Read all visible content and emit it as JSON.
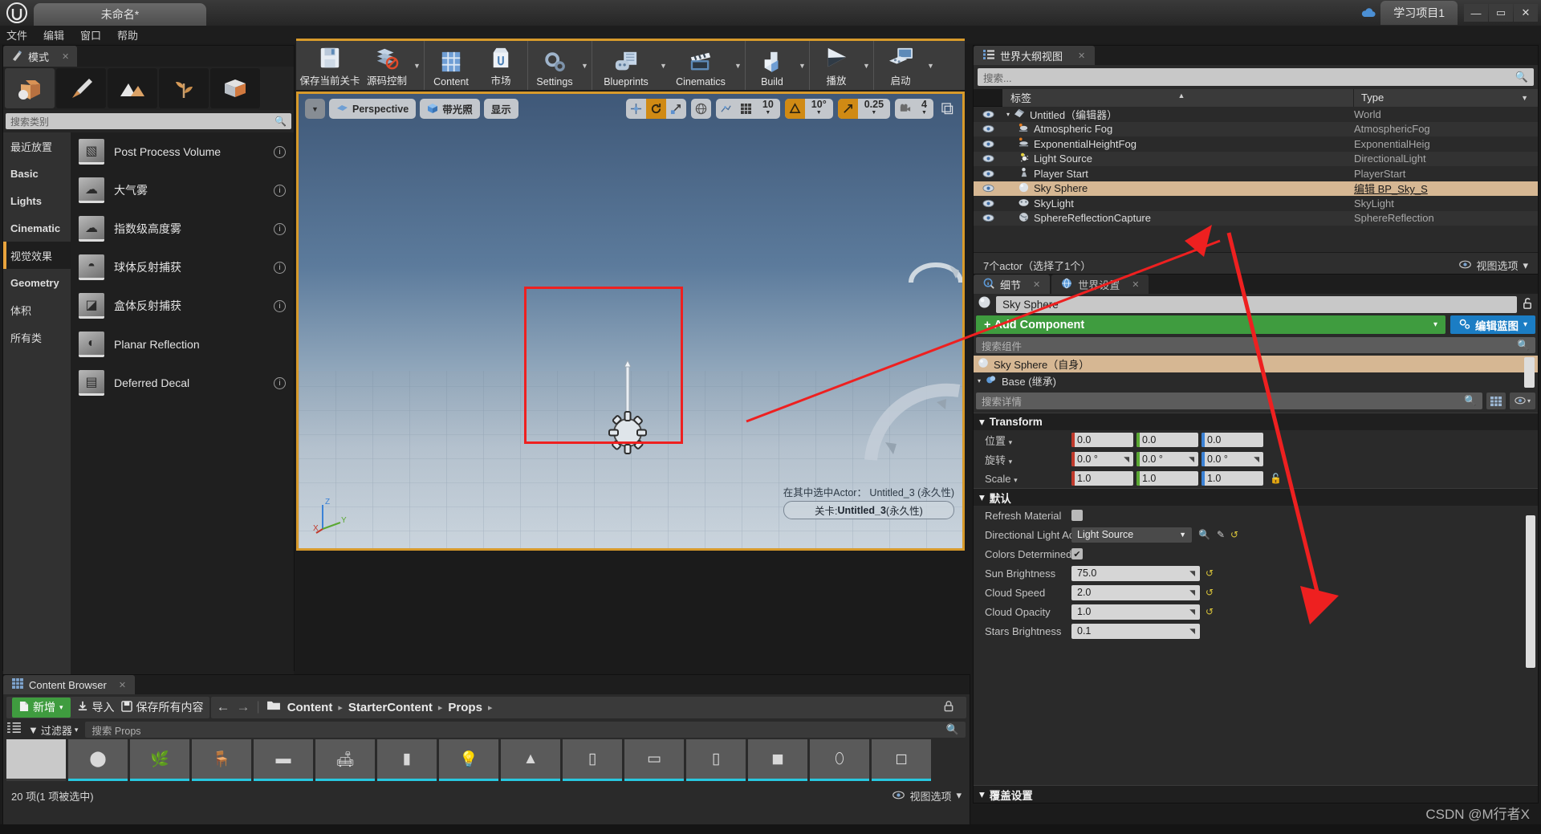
{
  "window": {
    "tab_title": "未命名*",
    "learn_tab": "学习项目1",
    "minimize": "—",
    "maximize": "▭",
    "close": "✕",
    "cloud_icon": "cloud-icon"
  },
  "menubar": {
    "items": [
      "文件",
      "编辑",
      "窗口",
      "帮助"
    ]
  },
  "modes": {
    "tab_label": "模式",
    "tab_close": "✕",
    "mode_icons": [
      "place-mode-icon",
      "paint-mode-icon",
      "landscape-mode-icon",
      "foliage-mode-icon",
      "geometry-mode-icon"
    ],
    "search_placeholder": "搜索类别",
    "categories": [
      {
        "label": "最近放置",
        "selected": false,
        "bold": false
      },
      {
        "label": "Basic",
        "selected": false,
        "bold": true
      },
      {
        "label": "Lights",
        "selected": false,
        "bold": true
      },
      {
        "label": "Cinematic",
        "selected": false,
        "bold": true
      },
      {
        "label": "视觉效果",
        "selected": true,
        "bold": false
      },
      {
        "label": "Geometry",
        "selected": false,
        "bold": true
      },
      {
        "label": "体积",
        "selected": false,
        "bold": false
      },
      {
        "label": "所有类",
        "selected": false,
        "bold": false
      }
    ],
    "items": [
      {
        "label": "Post Process Volume",
        "check": "✓"
      },
      {
        "label": "大气雾",
        "check": "✓"
      },
      {
        "label": "指数级高度雾",
        "check": "✓"
      },
      {
        "label": "球体反射捕获",
        "check": "✓"
      },
      {
        "label": "盒体反射捕获",
        "check": "✓"
      },
      {
        "label": "Planar Reflection",
        "check": ""
      },
      {
        "label": "Deferred Decal",
        "check": "✓"
      }
    ]
  },
  "toolbar": {
    "groups": [
      {
        "buttons": [
          {
            "label": "保存当前关卡",
            "icon": "save-icon",
            "caret": false,
            "wide": true
          },
          {
            "label": "源码控制",
            "icon": "source-control-icon",
            "caret": true,
            "wide": false
          }
        ]
      },
      {
        "buttons": [
          {
            "label": "Content",
            "icon": "content-icon",
            "caret": false,
            "wide": false
          },
          {
            "label": "市场",
            "icon": "marketplace-icon",
            "caret": false,
            "wide": false
          }
        ]
      },
      {
        "buttons": [
          {
            "label": "Settings",
            "icon": "gear-icon",
            "caret": true,
            "wide": false
          }
        ]
      },
      {
        "buttons": [
          {
            "label": "Blueprints",
            "icon": "blueprints-icon",
            "caret": true,
            "wide": true
          },
          {
            "label": "Cinematics",
            "icon": "cinematics-icon",
            "caret": true,
            "wide": true
          }
        ]
      },
      {
        "buttons": [
          {
            "label": "Build",
            "icon": "build-icon",
            "caret": true,
            "wide": false
          }
        ]
      },
      {
        "buttons": [
          {
            "label": "播放",
            "icon": "play-icon",
            "caret": true,
            "wide": false
          }
        ]
      },
      {
        "buttons": [
          {
            "label": "启动",
            "icon": "launch-icon",
            "caret": true,
            "wide": false
          }
        ]
      }
    ]
  },
  "viewport": {
    "caret": "▼",
    "perspective": "Perspective",
    "lit": "带光照",
    "show": "显示",
    "transform_modes": [
      "translate-icon",
      "rotate-icon",
      "scale-icon"
    ],
    "coord_icon": "world-coordinate-icon",
    "surface_snap_icon": "surface-snap-icon",
    "grid_icon": "grid-snap-icon",
    "grid_value": "10",
    "angle_icon": "angle-snap-icon",
    "angle_value": "10°",
    "scale_icon": "scale-snap-icon",
    "scale_value": "0.25",
    "camera_icon": "camera-speed-icon",
    "camera_value": "4",
    "maximize_icon": "maximize-viewport-icon",
    "status_line": "在其中选中Actor： Untitled_3 (永久性)",
    "level_prefix": "关卡: ",
    "level_name": "Untitled_3",
    "level_suffix": " (永久性)",
    "axis_x": "X",
    "axis_y": "Y",
    "axis_z": "Z"
  },
  "outliner": {
    "tab_label": "世界大纲视图",
    "tab_icon": "outliner-icon",
    "search_placeholder": "搜索...",
    "col_label": "标签",
    "col_type": "Type",
    "rows": [
      {
        "label": "Untitled（编辑器）",
        "type": "World",
        "icon": "world-icon",
        "indent": 0,
        "selected": false,
        "expander": "▾"
      },
      {
        "label": "Atmospheric Fog",
        "type": "AtmosphericFog",
        "icon": "fog-icon",
        "indent": 1,
        "selected": false,
        "expander": ""
      },
      {
        "label": "ExponentialHeightFog",
        "type": "ExponentialHeig",
        "icon": "height-fog-icon",
        "indent": 1,
        "selected": false,
        "expander": ""
      },
      {
        "label": "Light Source",
        "type": "DirectionalLight",
        "icon": "directional-light-icon",
        "indent": 1,
        "selected": false,
        "expander": ""
      },
      {
        "label": "Player Start",
        "type": "PlayerStart",
        "icon": "player-start-icon",
        "indent": 1,
        "selected": false,
        "expander": ""
      },
      {
        "label": "Sky Sphere",
        "type": "编辑 BP_Sky_S",
        "icon": "sky-sphere-icon",
        "indent": 1,
        "selected": true,
        "expander": ""
      },
      {
        "label": "SkyLight",
        "type": "SkyLight",
        "icon": "sky-light-icon",
        "indent": 1,
        "selected": false,
        "expander": ""
      },
      {
        "label": "SphereReflectionCapture",
        "type": "SphereReflection",
        "icon": "sphere-reflection-icon",
        "indent": 1,
        "selected": false,
        "expander": ""
      }
    ],
    "footer_count": "7个actor（选择了1个）",
    "footer_view_options": "视图选项",
    "footer_eye_icon": "eye-icon",
    "footer_caret": "▾"
  },
  "details": {
    "tab_details": "细节",
    "tab_details_icon": "details-icon",
    "tab_world_settings": "世界设置",
    "tab_world_icon": "world-settings-icon",
    "tab_close": "✕",
    "actor_name": "Sky Sphere",
    "actor_icon": "sphere-icon",
    "lock_icon": "unlock-icon",
    "add_component": "Add Component",
    "add_component_plus": "+",
    "add_component_caret": "▾",
    "edit_blueprint": "编辑蓝图",
    "edit_blueprint_icon": "gear-icon",
    "edit_blueprint_caret": "▾",
    "component_search_placeholder": "搜索组件",
    "components": [
      {
        "label": "Sky Sphere（自身）",
        "icon": "sphere-icon",
        "selected": true,
        "expander": ""
      },
      {
        "label": "Base (继承)",
        "icon": "mesh-icon",
        "selected": false,
        "expander": "▾"
      }
    ],
    "detail_search_placeholder": "搜索详情",
    "grid_button_icon": "grid-view-icon",
    "eye_button_icon": "eye-icon",
    "eye_caret": "▾",
    "transform_section": "Transform",
    "transform_rows": [
      {
        "label": "位置",
        "caret": "▾",
        "values": [
          "0.0",
          "0.0",
          "0.0"
        ],
        "suffix": ""
      },
      {
        "label": "旋转",
        "caret": "▾",
        "values": [
          "0.0 °",
          "0.0 °",
          "0.0 °"
        ],
        "suffix": "drag"
      },
      {
        "label": "Scale",
        "caret": "▾",
        "values": [
          "1.0",
          "1.0",
          "1.0"
        ],
        "suffix": "lock"
      }
    ],
    "default_section": "默认",
    "default_rows": [
      {
        "label": "Refresh Material",
        "kind": "checkbox",
        "checked": false,
        "value": ""
      },
      {
        "label": "Directional Light Ac",
        "kind": "combo",
        "value": "Light Source",
        "extra_icons": [
          "search-icon",
          "eyedropper-icon",
          "reset-icon"
        ]
      },
      {
        "label": "Colors Determined",
        "kind": "checkbox",
        "checked": true,
        "value": ""
      },
      {
        "label": "Sun Brightness",
        "kind": "number",
        "value": "75.0",
        "reset": true
      },
      {
        "label": "Cloud Speed",
        "kind": "number",
        "value": "2.0",
        "reset": true
      },
      {
        "label": "Cloud Opacity",
        "kind": "number",
        "value": "1.0",
        "reset": true
      },
      {
        "label": "Stars Brightness",
        "kind": "number",
        "value": "0.1",
        "reset": false
      }
    ],
    "bottom_section": "覆盖设置"
  },
  "content_browser": {
    "tab_label": "Content Browser",
    "tab_icon": "content-browser-icon",
    "tab_close": "✕",
    "new_button": "新增",
    "new_caret": "▾",
    "import_button": "导入",
    "import_icon": "import-icon",
    "save_all_button": "保存所有内容",
    "save_all_icon": "save-icon",
    "back_icon": "←",
    "forward_icon": "→",
    "folder_icon": "folder-icon",
    "breadcrumbs": [
      "Content",
      "StarterContent",
      "Props"
    ],
    "crumb_sep": "▸",
    "lock_icon": "lock-icon",
    "sources_icon": "sources-panel-icon",
    "filter_label": "过滤器",
    "filter_icon": "filter-icon",
    "filter_caret": "▾",
    "search_placeholder": "搜索 Props",
    "assets": [
      "asset-plain",
      "asset-sphere",
      "asset-plant",
      "asset-chair",
      "asset-box",
      "asset-bench",
      "asset-pillar",
      "asset-lamp",
      "asset-cone",
      "asset-stand",
      "asset-table",
      "asset-board",
      "asset-crate",
      "asset-statue",
      "asset-misc"
    ],
    "footer_count": "20 项(1 项被选中)",
    "footer_view_options": "视图选项",
    "footer_eye_icon": "eye-icon",
    "footer_caret": "▾"
  },
  "annotations": {
    "accent_color": "#ee2020",
    "arrow_to_outliner": "red-arrow-to-sky-sphere-row",
    "arrow_to_default": "red-arrow-to-default-section",
    "selection_box": "red-selection-box-around-sky-sphere"
  },
  "watermark": "CSDN @M行者X"
}
